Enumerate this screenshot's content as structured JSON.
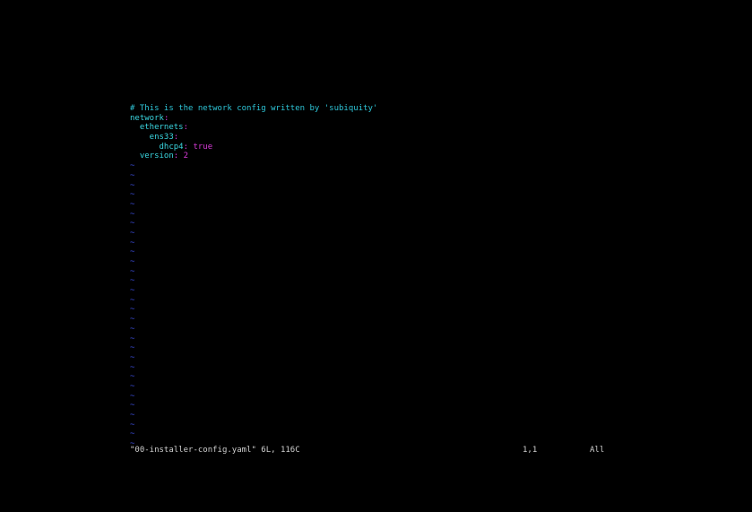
{
  "editor": {
    "lines": [
      {
        "parts": [
          {
            "text": "# This is the network config written by 'subiquity'",
            "cls": "comment"
          }
        ]
      },
      {
        "parts": [
          {
            "text": "network",
            "cls": "key"
          },
          {
            "text": ":",
            "cls": "colon"
          }
        ]
      },
      {
        "parts": [
          {
            "text": "  ethernets",
            "cls": "key"
          },
          {
            "text": ":",
            "cls": "colon"
          }
        ]
      },
      {
        "parts": [
          {
            "text": "    ens33",
            "cls": "key"
          },
          {
            "text": ":",
            "cls": "colon"
          }
        ]
      },
      {
        "parts": [
          {
            "text": "      dhcp4",
            "cls": "key"
          },
          {
            "text": ": ",
            "cls": "colon"
          },
          {
            "text": "true",
            "cls": "value"
          }
        ]
      },
      {
        "parts": [
          {
            "text": "  version",
            "cls": "key"
          },
          {
            "text": ": ",
            "cls": "colon"
          },
          {
            "text": "2",
            "cls": "value"
          }
        ]
      }
    ],
    "tilde_char": "~",
    "empty_line_count": 30
  },
  "status": {
    "file_info": "\"00-installer-config.yaml\" 6L, 116C",
    "cursor_position": "1,1",
    "scroll_position": "All"
  },
  "colors": {
    "background": "#000000",
    "comment": "#2ec4d6",
    "key": "#3ad6e0",
    "punct_value": "#d63ad6",
    "tilde": "#3a4bd6",
    "status_text": "#cfcfcf"
  }
}
